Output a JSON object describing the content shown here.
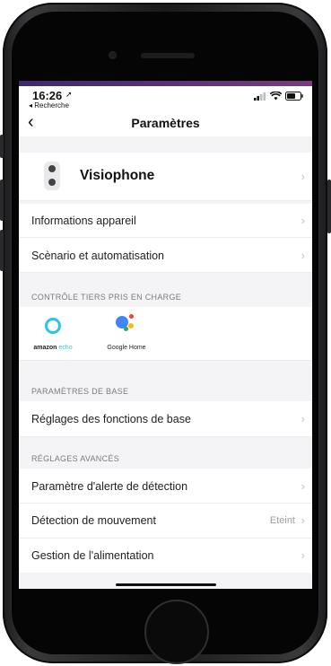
{
  "status": {
    "time": "16:26",
    "back_app": "◂ Recherche"
  },
  "nav": {
    "back_icon": "chevron-left-icon",
    "title": "Paramètres"
  },
  "device": {
    "name": "Visiophone"
  },
  "rows": {
    "info": "Informations appareil",
    "scenario": "Scènario et automatisation",
    "base_settings": "Réglages des fonctions de base",
    "alert": "Paramètre d'alerte de détection",
    "motion": "Détection de mouvement",
    "motion_value": "Eteint",
    "power": "Gestion de l'alimentation"
  },
  "sections": {
    "third_party": "CONTRÔLE TIERS PRIS EN CHARGE",
    "base": "PARAMÈTRES DE BASE",
    "advanced": "RÉGLAGES AVANCÉS"
  },
  "brands": {
    "amazon": "amazon",
    "echo": "echo",
    "google": "Google Home"
  },
  "colors": {
    "alexa": "#27c4f4",
    "google_blue": "#4285f4",
    "google_red": "#ea4335",
    "google_yellow": "#fbbc05",
    "google_green": "#34a853"
  }
}
